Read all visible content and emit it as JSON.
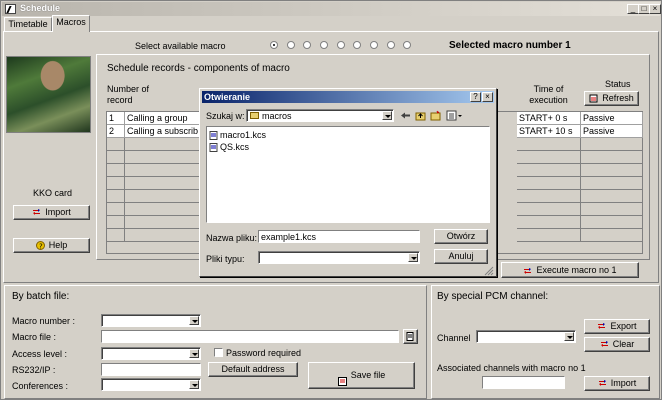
{
  "window": {
    "title": "Schedule",
    "controls": [
      "_",
      "□",
      "×"
    ]
  },
  "tabs": [
    {
      "label": "Timetable",
      "active": false
    },
    {
      "label": "Macros",
      "active": true
    }
  ],
  "macro_select": {
    "label": "Select available macro",
    "selected_text": "Selected macro number 1",
    "radio_count": 9,
    "selected_index": 0
  },
  "left_panel": {
    "card_label": "KKO card",
    "import_button": "Import",
    "help_button": "Help"
  },
  "records": {
    "title": "Schedule records - components of macro",
    "columns": {
      "number": "Number of record",
      "time": "Time of execution",
      "status": "Status"
    },
    "refresh_button": "Refresh",
    "rows": [
      {
        "number": "1",
        "name": "Calling a group",
        "time": "START+ 0 s",
        "status": "Passive"
      },
      {
        "number": "2",
        "name": "Calling a subscrib",
        "time": "START+ 10 s",
        "status": "Passive"
      }
    ]
  },
  "execute_button": "Execute macro no 1",
  "batch": {
    "title": "By batch file:",
    "macro_number_label": "Macro number :",
    "macro_file_label": "Macro file :",
    "access_level_label": "Access level :",
    "password_label": "Password required",
    "rs232_label": "RS232/IP :",
    "default_address_button": "Default address",
    "conferences_label": "Conferences :",
    "save_button": "Save file"
  },
  "pcm": {
    "title": "By special PCM channel:",
    "channel_label": "Channel",
    "export_button": "Export",
    "clear_button": "Clear",
    "associated_label": "Associated channels with macro no 1",
    "import_button": "Import"
  },
  "dialog": {
    "title": "Otwieranie",
    "look_in_label": "Szukaj w:",
    "look_in_value": "macros",
    "files": [
      "macro1.kcs",
      "QS.kcs"
    ],
    "filename_label": "Nazwa pliku:",
    "filename_value": "example1.kcs",
    "filetype_label": "Pliki typu:",
    "open_button": "Otwórz",
    "cancel_button": "Anuluj",
    "title_buttons": [
      "?",
      "×"
    ]
  },
  "colors": {
    "face": "#d4d0c8",
    "dialog_title": "#0a246a",
    "dialog_title_end": "#a6caf0"
  }
}
